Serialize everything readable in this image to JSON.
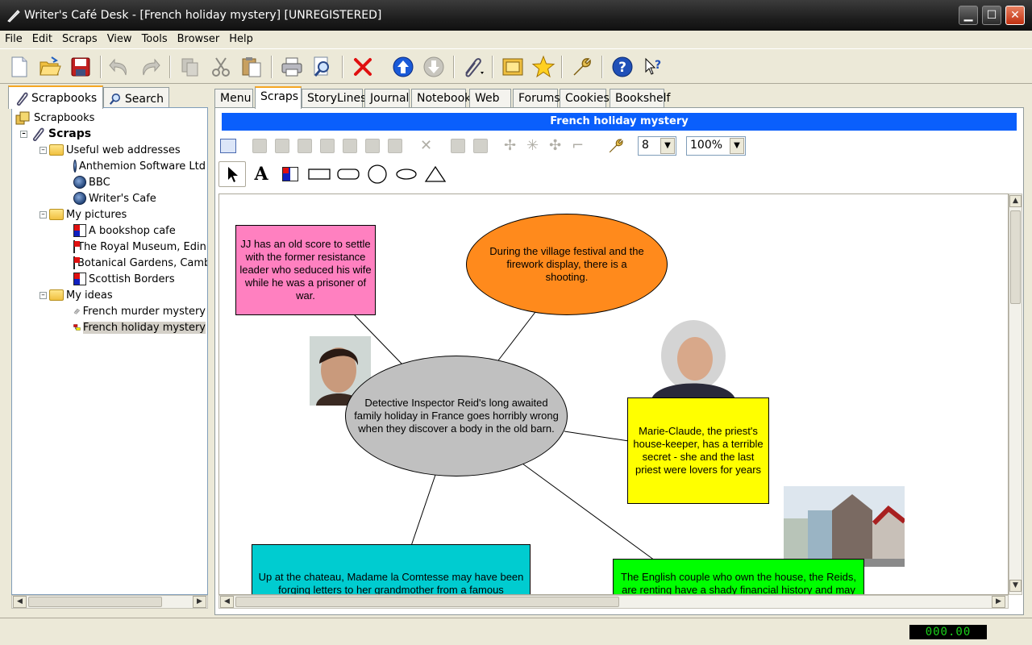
{
  "window": {
    "title": "Writer's Café Desk - [French holiday mystery] [UNREGISTERED]",
    "min_label": "▁",
    "max_label": "☐",
    "close_label": "✕"
  },
  "menu": [
    "File",
    "Edit",
    "Scraps",
    "View",
    "Tools",
    "Browser",
    "Help"
  ],
  "toolbar": {
    "buttons": [
      "new-icon",
      "open-icon",
      "save-icon",
      "undo-icon",
      "redo-icon",
      "copy-icon",
      "cut-icon",
      "paste-icon",
      "print-icon",
      "print-preview-icon",
      "delete-icon",
      "move-up-icon",
      "move-down-icon",
      "attach-icon",
      "frame-icon",
      "star-icon",
      "wrench-icon",
      "help-icon",
      "context-help-icon"
    ]
  },
  "left_tabs": {
    "scrapbooks": "Scrapbooks",
    "search": "Search"
  },
  "tree": {
    "root": "Scrapbooks",
    "scraps": "Scraps",
    "folders": [
      {
        "label": "Useful web addresses",
        "items": [
          "Anthemion Software Ltd",
          "BBC",
          "Writer's Cafe"
        ]
      },
      {
        "label": "My pictures",
        "items": [
          "A bookshop cafe",
          "The Royal Museum, Edinburgh",
          "Botanical Gardens, Cambridge",
          "Scottish Borders"
        ]
      },
      {
        "label": "My ideas",
        "items": [
          "French murder mystery",
          "French holiday mystery"
        ]
      }
    ]
  },
  "right_tabs": [
    "Menu",
    "Scraps",
    "StoryLines",
    "Journal",
    "Notebook",
    "Web",
    "Forums",
    "Cookies",
    "Bookshelf"
  ],
  "document": {
    "title": "French holiday mystery",
    "font_size": "8",
    "zoom": "100%"
  },
  "canvas": {
    "notes": {
      "jj": "JJ has an old score to settle with the former resistance leader who seduced his wife while he was a prisoner of war.",
      "festival": "During the village festival and the firework display, there is a shooting.",
      "central": "Detective Inspector Reid's long awaited family holiday in France goes horribly wrong when they discover a body in the old barn.",
      "marie": "Marie-Claude, the priest's house-keeper, has a terrible secret - she and the last priest were lovers for years",
      "chateau": "Up at the chateau, Madame la Comtesse may have been forging letters to her grandmother from a famous",
      "english": "The English couple who own the house, the Reids, are renting have a shady financial history and may"
    },
    "colors": {
      "jj": "#ff80c0",
      "festival": "#ff8a1c",
      "central": "#c0c0c0",
      "marie": "#ffff00",
      "chateau": "#00ccd0",
      "english": "#00ff00"
    }
  },
  "status": {
    "text": "",
    "clock": "000.00"
  }
}
